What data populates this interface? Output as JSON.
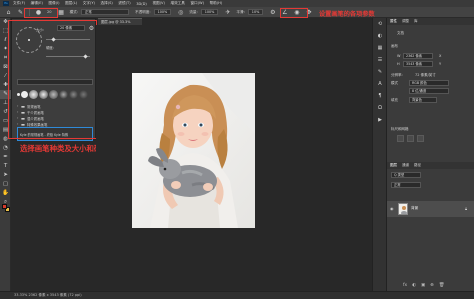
{
  "menu": {
    "app_logo": "Ps",
    "items": [
      "文件(F)",
      "编辑(E)",
      "图像(I)",
      "图层(L)",
      "文字(Y)",
      "选择(S)",
      "滤镜(T)",
      "3D(D)",
      "视图(V)",
      "增效工具",
      "窗口(W)",
      "帮助(H)"
    ]
  },
  "options": {
    "mode_label": "模式:",
    "mode_value": "正常",
    "opacity_label": "不透明度:",
    "opacity_value": "100%",
    "flow_label": "流量:",
    "flow_value": "100%",
    "smoothing_label": "平滑:",
    "smoothing_value": "10%",
    "brush_size_value": "20"
  },
  "annotations": {
    "top_right": "设置画笔的各项参数",
    "left": "选择画笔种类及大小和硬度"
  },
  "brush_picker": {
    "size_label": "大小:",
    "size_value": "20 像素",
    "hardness_label": "硬度:",
    "search_placeholder": "",
    "folders": [
      "常规画笔",
      "干介质画笔",
      "湿介质画笔",
      "特殊效果画笔"
    ],
    "selected_preset": "Kyle 的常规画笔 - 终极 Kyle 特殊"
  },
  "document": {
    "tab_title": "图层.jpg @ 33.3%",
    "status_text": "33.33%   2362 像素 x 3543 像素 (72 ppi)"
  },
  "right_panel": {
    "top_tabs": [
      "属性",
      "调整",
      "库"
    ],
    "doc_label": "文档",
    "canvas_label": "画布",
    "width_label": "W",
    "width_value": "2362 像素",
    "height_label": "H",
    "height_value": "3543 像素",
    "x_label": "X",
    "y_label": "Y",
    "resolution_label": "分辨率:",
    "resolution_value": "72 像素/英寸",
    "mode_label": "模式",
    "mode_value": "RGB 颜色",
    "depth_value": "8 位/通道",
    "fill_label": "填充",
    "fill_value": "背景色",
    "guides_label": "标尺和网格",
    "layers_tabs": [
      "图层",
      "通道",
      "路径"
    ],
    "layers_kind": "Q 类型",
    "layers_blend": "正常",
    "layer_name": "背景",
    "footer_icons": [
      "fx",
      "◐",
      "▣",
      "⊕",
      "🗑"
    ]
  }
}
